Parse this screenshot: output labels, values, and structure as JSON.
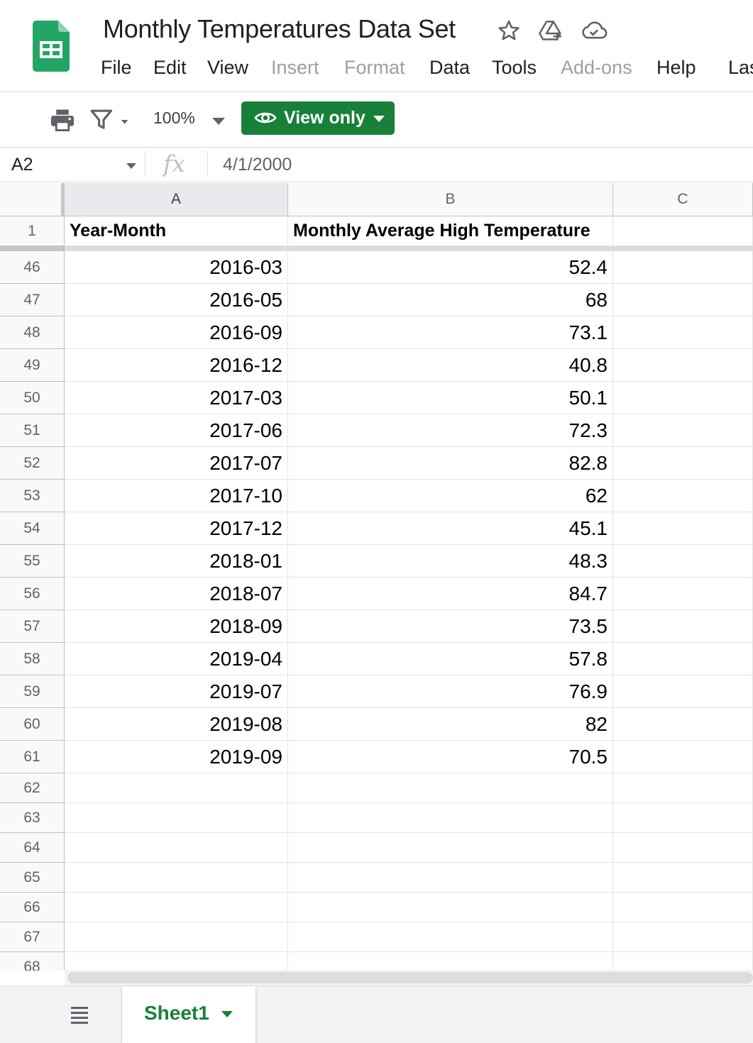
{
  "document": {
    "title": "Monthly Temperatures Data Set"
  },
  "menu": [
    "File",
    "Edit",
    "View",
    "Insert",
    "Format",
    "Data",
    "Tools",
    "Add-ons",
    "Help",
    "Las"
  ],
  "menu_disabled": [
    "Insert",
    "Format",
    "Add-ons"
  ],
  "toolbar": {
    "zoom": "100%",
    "view_only_label": "View only"
  },
  "formula_bar": {
    "name_box": "A2",
    "formula_value": "4/1/2000"
  },
  "columns": [
    "A",
    "B",
    "C"
  ],
  "header_row": {
    "row_number": "1",
    "a": "Year-Month",
    "b": "Monthly Average High Temperature",
    "c": ""
  },
  "rows": [
    {
      "n": "46",
      "a": "2016-03",
      "b": "52.4"
    },
    {
      "n": "47",
      "a": "2016-05",
      "b": "68"
    },
    {
      "n": "48",
      "a": "2016-09",
      "b": "73.1"
    },
    {
      "n": "49",
      "a": "2016-12",
      "b": "40.8"
    },
    {
      "n": "50",
      "a": "2017-03",
      "b": "50.1"
    },
    {
      "n": "51",
      "a": "2017-06",
      "b": "72.3"
    },
    {
      "n": "52",
      "a": "2017-07",
      "b": "82.8"
    },
    {
      "n": "53",
      "a": "2017-10",
      "b": "62"
    },
    {
      "n": "54",
      "a": "2017-12",
      "b": "45.1"
    },
    {
      "n": "55",
      "a": "2018-01",
      "b": "48.3"
    },
    {
      "n": "56",
      "a": "2018-07",
      "b": "84.7"
    },
    {
      "n": "57",
      "a": "2018-09",
      "b": "73.5"
    },
    {
      "n": "58",
      "a": "2019-04",
      "b": "57.8"
    },
    {
      "n": "59",
      "a": "2019-07",
      "b": "76.9"
    },
    {
      "n": "60",
      "a": "2019-08",
      "b": "82"
    },
    {
      "n": "61",
      "a": "2019-09",
      "b": "70.5"
    },
    {
      "n": "62",
      "a": "",
      "b": ""
    },
    {
      "n": "63",
      "a": "",
      "b": ""
    },
    {
      "n": "64",
      "a": "",
      "b": ""
    },
    {
      "n": "65",
      "a": "",
      "b": ""
    },
    {
      "n": "66",
      "a": "",
      "b": ""
    },
    {
      "n": "67",
      "a": "",
      "b": ""
    },
    {
      "n": "68",
      "a": "",
      "b": ""
    }
  ],
  "sheet_tabs": [
    {
      "label": "Sheet1",
      "active": true
    }
  ],
  "colors": {
    "brand_green": "#188038",
    "sheets_logo_green": "#23a566",
    "disabled_text": "#9aa0a6"
  },
  "icons": [
    "sheets-logo-icon",
    "star-icon",
    "move-to-drive-icon",
    "cloud-status-icon",
    "print-icon",
    "filter-icon",
    "eye-icon",
    "all-sheets-icon"
  ]
}
